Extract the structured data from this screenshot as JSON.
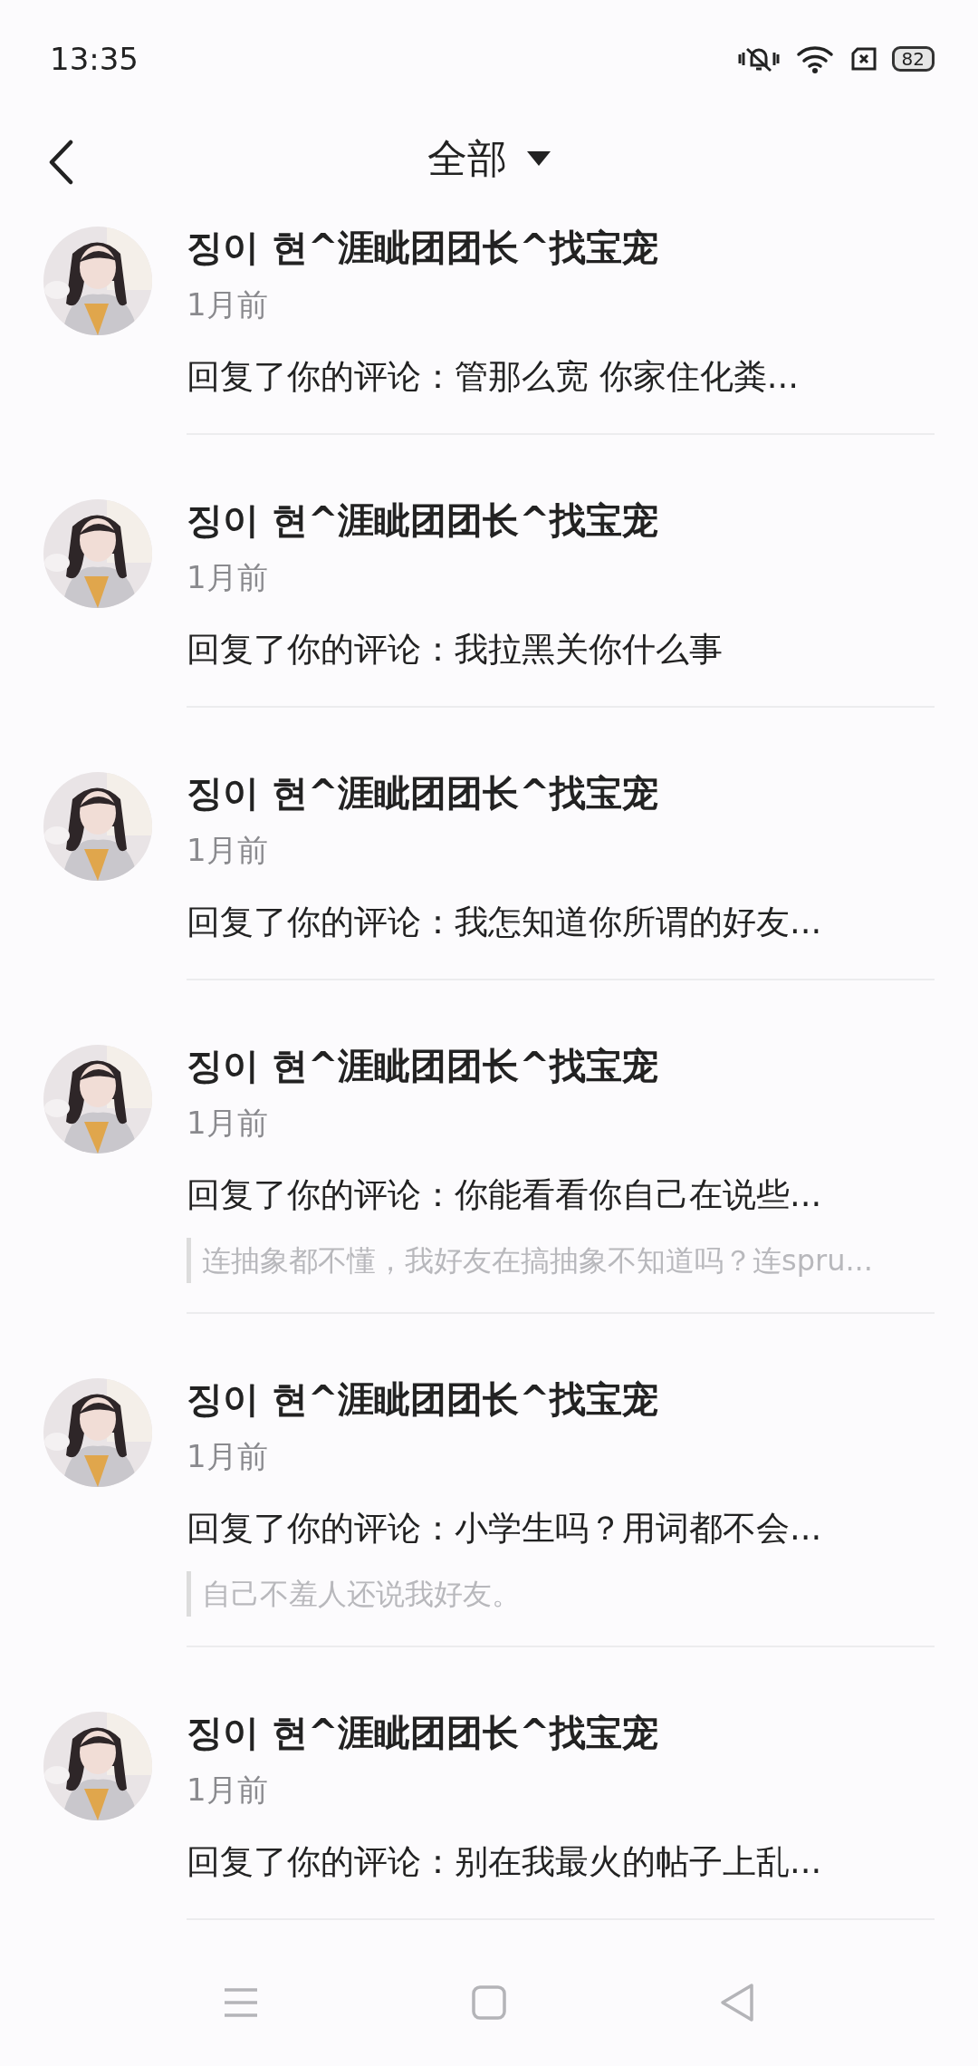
{
  "status_bar": {
    "time": "13:35",
    "battery": "82"
  },
  "header": {
    "title": "全部"
  },
  "notifications": [
    {
      "name": "징이 현^涯眦团团长^找宝宠",
      "time": "1月前",
      "comment": "回复了你的评论：管那么宽 你家住化粪..."
    },
    {
      "name": "징이 현^涯眦团团长^找宝宠",
      "time": "1月前",
      "comment": "回复了你的评论：我拉黑关你什么事"
    },
    {
      "name": "징이 현^涯眦团团长^找宝宠",
      "time": "1月前",
      "comment": "回复了你的评论：我怎知道你所谓的好友..."
    },
    {
      "name": "징이 현^涯眦团团长^找宝宠",
      "time": "1月前",
      "comment": "回复了你的评论：你能看看你自己在说些...",
      "quote": "连抽象都不懂，我好友在搞抽象不知道吗？连spru..."
    },
    {
      "name": "징이 현^涯眦团团长^找宝宠",
      "time": "1月前",
      "comment": "回复了你的评论：小学生吗？用词都不会...",
      "quote": "自己不羞人还说我好友。"
    },
    {
      "name": "징이 현^涯眦团团长^找宝宠",
      "time": "1月前",
      "comment": "回复了你的评论：别在我最火的帖子上乱..."
    }
  ]
}
